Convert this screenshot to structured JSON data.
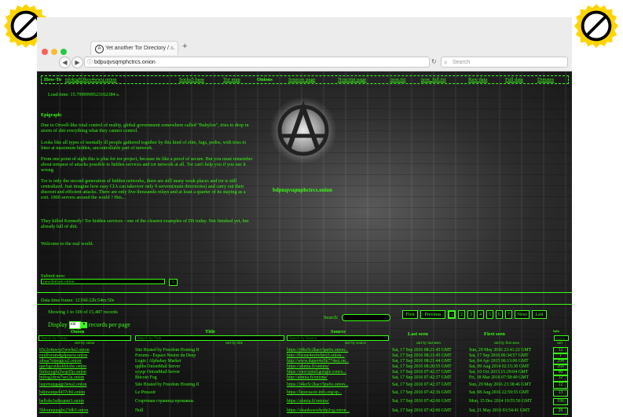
{
  "browser": {
    "tab_title": "Yet another Tor Directory / ...",
    "tab_close": "×",
    "new_tab": "+",
    "url": "bdpuqvsqmphctrcs.onion",
    "search_placeholder": "Search"
  },
  "nav": [
    {
      "label": "How-To",
      "key": "howto"
    },
    {
      "label": "nfokjgfj3hsx4wwu.onion",
      "key": "mirror"
    },
    {
      "label": "Socks5 base",
      "key": "socks5"
    },
    {
      "label": "Tor map",
      "key": "tormap"
    },
    {
      "label": "Onions",
      "key": "onions"
    },
    {
      "label": "Sources page",
      "key": "sources"
    },
    {
      "label": "Noscript page",
      "key": "noscript"
    },
    {
      "label": "json.txt",
      "key": "json"
    },
    {
      "label": "json_full.txt",
      "key": "jsonfull"
    },
    {
      "label": "Raw data",
      "key": "raw"
    },
    {
      "label": "Full data",
      "key": "full"
    },
    {
      "label": "Donates",
      "key": "donates"
    }
  ],
  "load_time": "Load time: 15.7999999523162384 s.",
  "epigraph_title": "Epigraph:",
  "epigraph": [
    "Due to Orwell-like total control of reality, global government somewhere called \"Babylon\", tries to drop in storm of shit everything what they cannot control.",
    "Looks like all types of mentally ill people gathered together by this kind of elite, fags, pedos, with tries to litter at maximum hidden, uncontrollable part of network.",
    "From one point of sight this is plus for tor project, because its like a proof of secure. But you must remember about tempest of attacks possible to hidden services and tor network at all. Tor can't help you if you use it wrong.",
    "Tor is only the second generation of hidden networks, there are still many weak places and tor is still centralized. Just imagine how easy CIA can takeover only 9 servers(main directories) and carry out their discreet and efficient attacks. There are only five thousands relays and at least a quarter of its staying as a exit. 1000 servers around the world ? Hm...",
    "They killed Kennedy! Tor hidden services - one of the clearest examples of DS today. Not finished yet, but already full of shit.",
    "Welcome to the real world."
  ],
  "site_onion": "bdpuqvsqmphctrcs.onion",
  "submit": {
    "label": "Submit new:",
    "value": "newdomain.onion",
    "button": "o"
  },
  "time_frame": "Data time frame: 1210d-22h:54m:50s",
  "showing": "Showing 1 to 100 of 15,487 records",
  "display": {
    "before": "Display",
    "value": "100",
    "after": "records per page"
  },
  "search_label": "Search:",
  "pager": {
    "first": "First",
    "previous": "Previous",
    "pages": [
      "1",
      "2",
      "3",
      "4",
      "5",
      "6",
      "7"
    ],
    "current": "1",
    "next": "Next",
    "last": "Last"
  },
  "columns": {
    "onion": "Onion",
    "title": "Title",
    "source": "Source",
    "last_seen": "Last seen",
    "first_seen": "First seen",
    "info": "Info"
  },
  "filters": {
    "onion": "Search by Onion",
    "title": "Search by Title",
    "source": "Search by Source",
    "info": "Search"
  },
  "sort": {
    "onion": "sort by onion",
    "title": "sort by title",
    "source": "sort by source",
    "last_seen": "sort by last seen",
    "first_seen": "sort by first seen",
    "info": "sort"
  },
  "rows": [
    {
      "onion": "65c2z4uwyz5wwhe2.onion",
      "title": "Site Hosted by Freedom Hosting II",
      "source": "https://j4ko5c2kacr3pu6x.onion...",
      "last": "Sat, 17 Sep 2016 08:21:45 GMT",
      "first": "Sun, 29 May 2016 23:41:22 GMT",
      "info": "12"
    },
    {
      "onion": "enidforum4gdpraew.onion",
      "title": "Forums - Espace Neutre du Deep",
      "source": "http://ffzone4ey6efpvj3.onion...",
      "last": "Sat, 17 Sep 2016 08:21:45 GMT",
      "first": "Sat, 17 Sep 2016 06:34:57 GMT",
      "info": "1"
    },
    {
      "onion": "zibaa7irtpegicu2.onion",
      "title": "Login | Alphabay Market",
      "source": "http://www.duper4o5k774sej.on...",
      "last": "Sat, 17 Sep 2016 08:21:44 GMT",
      "first": "Sat, 04 Apr 2015 06:13:06 GMT",
      "info": "294"
    },
    {
      "onion": "qqvbgcu6kohbkxbs.onion",
      "title": "qqbbs OnionMail Server",
      "source": "https://ahmia.fi/onions/",
      "last": "Sat, 17 Sep 2016 08:20:55 GMT",
      "first": "Sat, 09 Aug 2014 02:15:30 GMT",
      "info": "260"
    },
    {
      "onion": "finbsyygfu3wqet5p.onion",
      "title": "syyqe OnionMail Server",
      "source": "https://encrypted.google.com/s...",
      "last": "Sat, 17 Sep 2016 07:42:37 GMT",
      "first": "Sat, 10 Oct 2015 15:29:04 GMT",
      "info": "90"
    },
    {
      "onion": "btifog2dyw7sec2a.onion",
      "title": "Bitcoin Fog",
      "source": "http://ahmia.fi/onions/",
      "last": "Sat, 17 Sep 2016 07:42:37 GMT",
      "first": "Fri, 18 Mar 2016 07:58:40 GMT",
      "info": "32"
    },
    {
      "onion": "luqymqqgagp3ena2.onion",
      "title": "Site Hosted by Freedom Hosting II",
      "source": "https://j4ko5c2kacr3pu6x.onion...",
      "last": "Sat, 17 Sep 2016 07:42:37 GMT",
      "first": "Sun, 29 May 2016 23:38:46 GMT",
      "info": "12"
    },
    {
      "onion": "b4jmontpel437ch6.onion",
      "title": "Le Pressoir",
      "source": "https://lepressoir-info.org/sp...",
      "last": "Sat, 17 Sep 2016 07:42:36 GMT",
      "first": "Sat, 08 Aug 2016 22:59:55 GMT",
      "info": "13"
    },
    {
      "onion": "hellobs3sdieqnm3.onion",
      "title": "Стартовая страница прокавшь",
      "source": "https://ahmia.fi/onions/",
      "last": "Sat, 17 Sep 2016 07:42:06 GMT",
      "first": "Mon, 15 Dec 2014 19:55:56 GMT",
      "info": "196"
    },
    {
      "onion": "5bbxmqqugbc23dh3.onion",
      "title": "Null",
      "source": "https://skunksworkedp2cg.onion...",
      "last": "Sat, 17 Sep 2016 07:42:06 GMT",
      "first": "Sat, 21 May 2016 03:54:41 GMT",
      "info": "20"
    }
  ],
  "colors": {
    "accent": "#39ff14",
    "background": "#161616",
    "badge": "#ffd400"
  },
  "icons": [
    "info-icon",
    "reload-icon",
    "search-icon",
    "back-icon",
    "forward-icon",
    "anarchy-logo-icon",
    "no-symbol-icon"
  ]
}
